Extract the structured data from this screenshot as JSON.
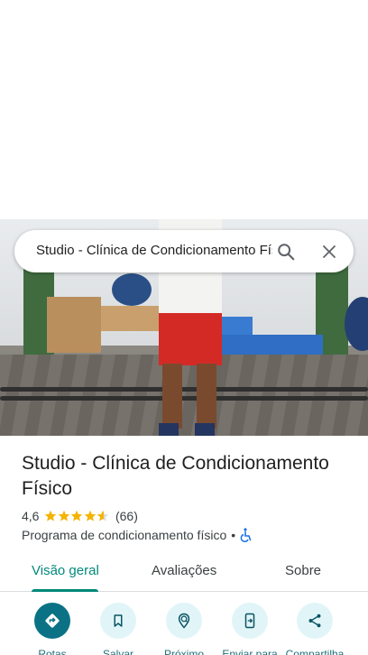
{
  "search": {
    "query": "Studio - Clínica de Condicionamento Físico"
  },
  "place": {
    "name": "Studio - Clínica de Condicionamento Físico",
    "rating": "4,6",
    "rating_stars": 4.6,
    "review_count": "(66)",
    "category": "Programa de condicionamento físico",
    "separator": "•"
  },
  "tabs": [
    {
      "label": "Visão geral",
      "active": true
    },
    {
      "label": "Avaliações",
      "active": false
    },
    {
      "label": "Sobre",
      "active": false
    }
  ],
  "actions": [
    {
      "label": "Rotas",
      "icon": "directions-icon"
    },
    {
      "label": "Salvar",
      "icon": "bookmark-icon"
    },
    {
      "label": "Próximo",
      "icon": "nearby-icon"
    },
    {
      "label": "Enviar para",
      "icon": "send-to-phone-icon"
    },
    {
      "label": "Compartilha",
      "icon": "share-icon"
    }
  ],
  "colors": {
    "accent": "#00897b",
    "primary_action": "#0b7285",
    "action_bg": "#e1f5f8",
    "star": "#f4b400",
    "accessibility": "#1a73e8"
  }
}
